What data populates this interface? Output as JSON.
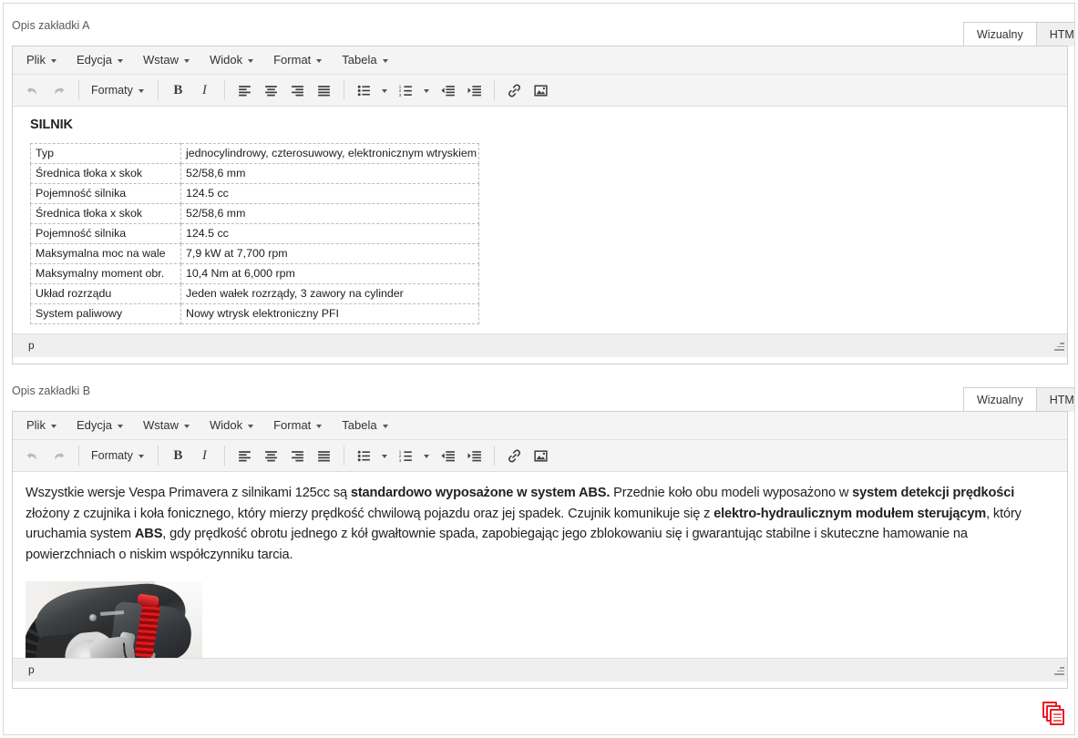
{
  "editors": [
    {
      "label": "Opis zakładki A",
      "tabs": [
        {
          "label": "Wizualny",
          "active": true
        },
        {
          "label": "HTML",
          "active": false
        }
      ],
      "menu": [
        "Plik",
        "Edycja",
        "Wstaw",
        "Widok",
        "Format",
        "Tabela"
      ],
      "toolbar": {
        "undo": "undo-icon",
        "redo": "redo-icon",
        "formats_label": "Formaty",
        "bold": "B",
        "italic": "I",
        "align_left": "align-left-icon",
        "align_center": "align-center-icon",
        "align_right": "align-right-icon",
        "align_justify": "align-justify-icon",
        "bullist": "bullet-list-icon",
        "numlist": "numbered-list-icon",
        "outdent": "outdent-icon",
        "indent": "indent-icon",
        "link": "link-icon",
        "image": "image-icon"
      },
      "content": {
        "heading": "SILNIK",
        "table": [
          [
            "Typ",
            "jednocylindrowy, czterosuwowy, elektronicznym wtryskiem"
          ],
          [
            "Średnica tłoka x skok",
            "52/58,6 mm"
          ],
          [
            "Pojemność silnika",
            "124.5 cc"
          ],
          [
            "Średnica tłoka x skok",
            "52/58,6 mm"
          ],
          [
            "Pojemność silnika",
            "124.5 cc"
          ],
          [
            "Maksymalna moc na wale",
            "7,9 kW at 7,700 rpm"
          ],
          [
            "Maksymalny moment obr.",
            "10,4 Nm at 6,000 rpm"
          ],
          [
            "Układ rozrządu",
            "Jeden wałek rozrządy, 3 zawory na cylinder"
          ],
          [
            "System paliwowy",
            "Nowy wtrysk elektroniczny PFI"
          ]
        ]
      },
      "statusbar": "p"
    },
    {
      "label": "Opis zakładki B",
      "tabs": [
        {
          "label": "Wizualny",
          "active": true
        },
        {
          "label": "HTML",
          "active": false
        }
      ],
      "menu": [
        "Plik",
        "Edycja",
        "Wstaw",
        "Widok",
        "Format",
        "Tabela"
      ],
      "toolbar": {
        "undo": "undo-icon",
        "redo": "redo-icon",
        "formats_label": "Formaty",
        "bold": "B",
        "italic": "I",
        "align_left": "align-left-icon",
        "align_center": "align-center-icon",
        "align_right": "align-right-icon",
        "align_justify": "align-justify-icon",
        "bullist": "bullet-list-icon",
        "numlist": "numbered-list-icon",
        "outdent": "outdent-icon",
        "indent": "indent-icon",
        "link": "link-icon",
        "image": "image-icon"
      },
      "content": {
        "paragraph_runs": [
          {
            "text": "Wszystkie wersje Vespa Primavera z silnikami 125cc są ",
            "bold": false
          },
          {
            "text": "standardowo wyposażone w system ABS.",
            "bold": true
          },
          {
            "text": "  Przednie koło obu modeli wyposażono w ",
            "bold": false
          },
          {
            "text": "system detekcji prędkości",
            "bold": true
          },
          {
            "text": " złożony z czujnika i koła fonicznego, który mierzy prędkość chwilową pojazdu oraz jej spadek. Czujnik komunikuje się z ",
            "bold": false
          },
          {
            "text": "elektro-hydraulicznym modułem sterującym",
            "bold": true
          },
          {
            "text": ", który uruchamia system ",
            "bold": false
          },
          {
            "text": "ABS",
            "bold": true
          },
          {
            "text": ", gdy prędkość obrotu jednego z kół gwałtownie spada, zapobiegając jego zblokowaniu się i gwarantując stabilne i skuteczne hamowanie na powierzchniach o niskim współczynniku tarcia.",
            "bold": false
          }
        ],
        "image_alt": "scooter-front-wheel-abs-photo"
      },
      "statusbar": "p"
    }
  ],
  "footer": {
    "copy_icon": "copy-documents-icon",
    "copy_icon_color": "#ed1c24"
  }
}
